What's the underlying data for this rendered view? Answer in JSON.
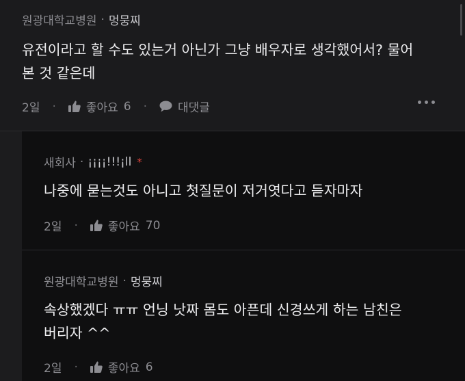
{
  "comments": [
    {
      "org": "원광대학교병원",
      "nick": "멍뭉찌",
      "text_line1": "유전이라고 할 수도 있는거 아닌가 그냥 배우자로 생각했어서? 물어",
      "text_line2": "본 것 같은데",
      "time": "2일",
      "like_label": "좋아요",
      "like_count": "6",
      "reply_label": "대댓글"
    },
    {
      "org": "새회사",
      "nick": "¡¡¡¡!!!¡ll",
      "badge": "*",
      "text_line1": "나중에 묻는것도 아니고 첫질문이 저거엿다고 듣자마자",
      "time": "2일",
      "like_label": "좋아요",
      "like_count": "70"
    },
    {
      "org": "원광대학교병원",
      "nick": "멍뭉찌",
      "text_line1": "속상했겠다 ㅠㅠ 언닝 낫짜 몸도 아픈데 신경쓰게 하는 남친은",
      "text_line2": "버리자 ^^",
      "time": "2일",
      "like_label": "좋아요",
      "like_count": "6"
    }
  ],
  "icons": {
    "like": "thumbs-up-icon",
    "reply": "speech-bubble-icon",
    "more": "more-horizontal-icon"
  }
}
